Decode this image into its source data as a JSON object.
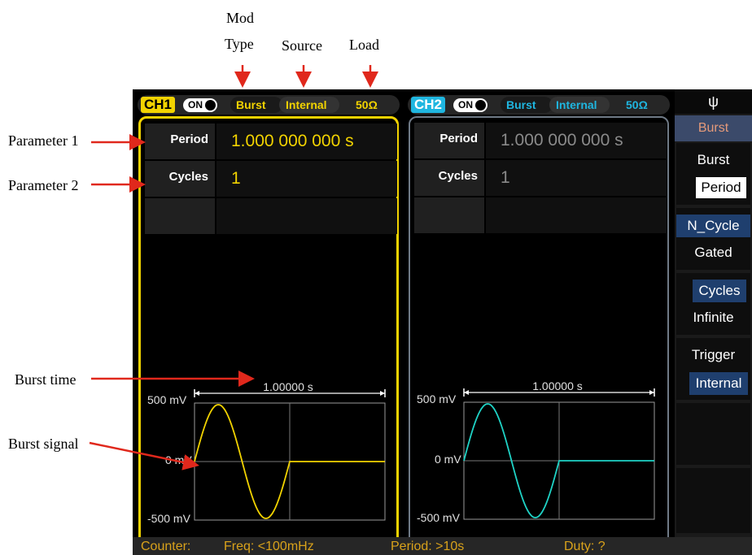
{
  "annotations": {
    "mod_type_line1": "Mod",
    "mod_type_line2": "Type",
    "source": "Source",
    "load": "Load",
    "parameter1": "Parameter 1",
    "parameter2": "Parameter 2",
    "burst_time": "Burst time",
    "burst_signal": "Burst signal"
  },
  "ch1": {
    "label": "CH1",
    "toggle": "ON",
    "mode": "Burst",
    "source": "Internal",
    "load": "50Ω",
    "params": [
      {
        "label": "Period",
        "value": "1.000 000 000 s"
      },
      {
        "label": "Cycles",
        "value": "1"
      }
    ],
    "waveform": {
      "time_label": "1.00000 s",
      "y_top": "500 mV",
      "y_mid": "0 mV",
      "y_bot": "-500 mV",
      "color": "#f2d300"
    }
  },
  "ch2": {
    "label": "CH2",
    "toggle": "ON",
    "mode": "Burst",
    "source": "Internal",
    "load": "50Ω",
    "params": [
      {
        "label": "Period",
        "value": "1.000 000 000 s"
      },
      {
        "label": "Cycles",
        "value": "1"
      }
    ],
    "waveform": {
      "time_label": "1.00000 s",
      "y_top": "500 mV",
      "y_mid": "0 mV",
      "y_bot": "-500 mV",
      "color": "#1fd3c6"
    }
  },
  "softkeys": {
    "usb_icon": "usb-icon",
    "title": "Burst",
    "groups": [
      {
        "options": [
          "Burst",
          "Period"
        ],
        "selected": 1
      },
      {
        "options": [
          "N_Cycle",
          "Gated"
        ],
        "selected": 0
      },
      {
        "options": [
          "Cycles",
          "Infinite"
        ],
        "selected": 0
      },
      {
        "options": [
          "Trigger",
          "Internal"
        ],
        "selected": 1
      }
    ]
  },
  "status": {
    "counter": "Counter:",
    "freq": "Freq: <100mHz",
    "period": "Period: >10s",
    "duty": "Duty: ?"
  },
  "colors": {
    "ch1_accent": "#f2d300",
    "ch2_accent": "#1fb6e0",
    "annotation_arrow": "#e0281c"
  }
}
